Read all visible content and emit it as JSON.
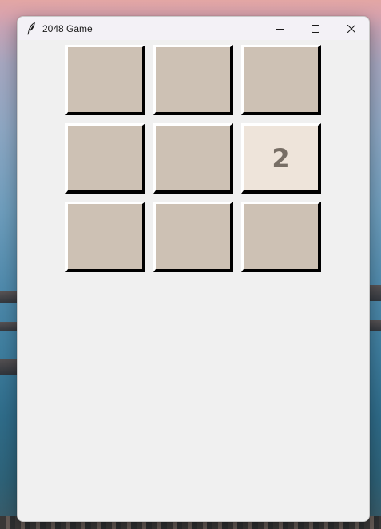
{
  "window": {
    "title": "2048 Game",
    "app_icon": "feather-icon",
    "controls": {
      "minimize_icon": "minimize-icon",
      "maximize_icon": "maximize-icon",
      "close_icon": "close-icon"
    }
  },
  "board": {
    "rows": 3,
    "cols": 3,
    "cells": [
      [
        "",
        "",
        ""
      ],
      [
        "",
        "",
        "2"
      ],
      [
        "",
        "",
        ""
      ]
    ]
  },
  "colors": {
    "empty_tile": "#cdc1b4",
    "tile_2": "#eee4da",
    "tile_text": "#776e65",
    "window_bg": "#f0f0f0"
  }
}
